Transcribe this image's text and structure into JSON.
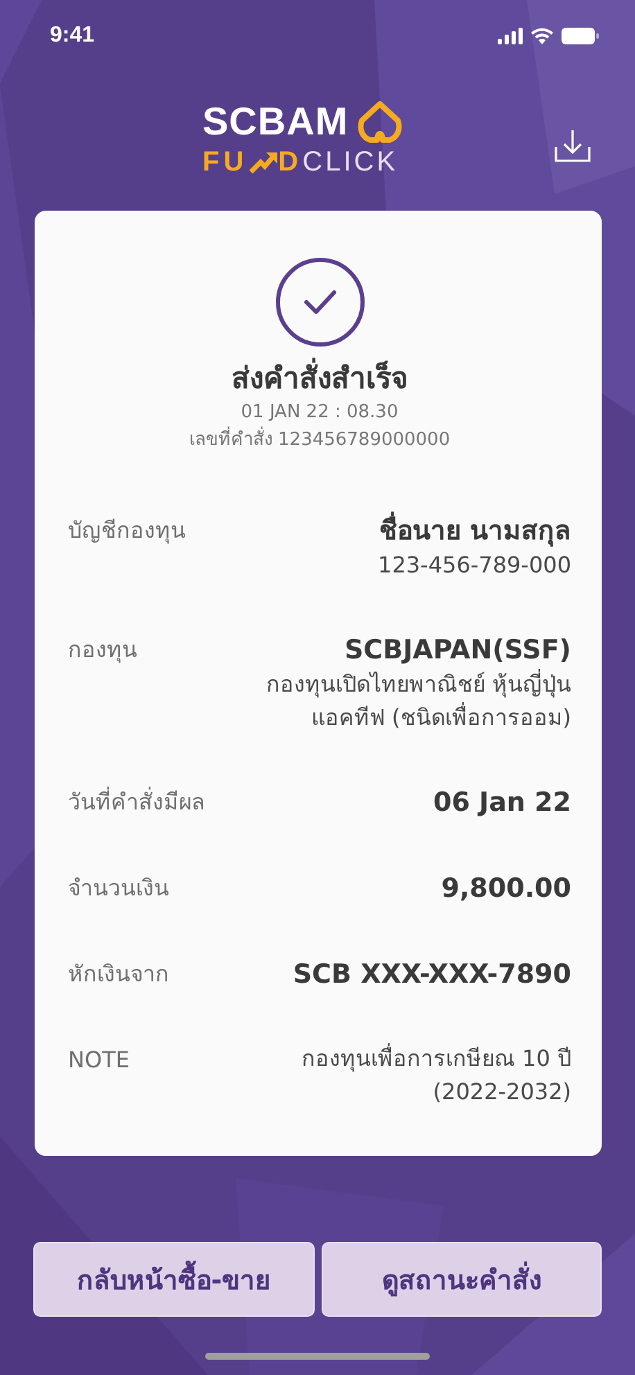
{
  "status_bar": {
    "time": "9:41"
  },
  "header": {
    "logo_top": "SCBAM",
    "logo_bottom": [
      "FU",
      "D",
      "CLICK"
    ]
  },
  "receipt": {
    "title": "ส่งคำสั่งสำเร็จ",
    "datetime": "01 JAN 22 : 08.30",
    "order_number": "เลขที่คำสั่ง 123456789000000",
    "rows": [
      {
        "label": "บัญชีกองทุน",
        "values": [
          {
            "text": "ชื่อนาย นามสกุล",
            "kind": "primary"
          },
          {
            "text": "123-456-789-000",
            "kind": "secondary"
          }
        ]
      },
      {
        "label": "กองทุน",
        "values": [
          {
            "text": "SCBJAPAN(SSF)",
            "kind": "primary"
          },
          {
            "text": "กองทุนเปิดไทยพาณิชย์ หุ้นญี่ปุ่น",
            "kind": "secondary"
          },
          {
            "text": "แอคทีฟ (ชนิดเพื่อการออม)",
            "kind": "secondary"
          }
        ]
      },
      {
        "label": "วันที่คำสั่งมีผล",
        "values": [
          {
            "text": "06 Jan 22",
            "kind": "primary"
          }
        ]
      },
      {
        "label": "จำนวนเงิน",
        "values": [
          {
            "text": "9,800.00",
            "kind": "primary"
          }
        ]
      },
      {
        "label": "หักเงินจาก",
        "values": [
          {
            "text": "SCB XXX-XXX-7890",
            "kind": "primary"
          }
        ]
      },
      {
        "label": "NOTE",
        "values": [
          {
            "text": "กองทุนเพื่อการเกษียณ 10 ปี",
            "kind": "secondary"
          },
          {
            "text": "(2022-2032)",
            "kind": "secondary"
          }
        ]
      }
    ]
  },
  "buttons": [
    "กลับหน้าซื้อ-ขาย",
    "ดูสถานะคำสั่ง"
  ]
}
